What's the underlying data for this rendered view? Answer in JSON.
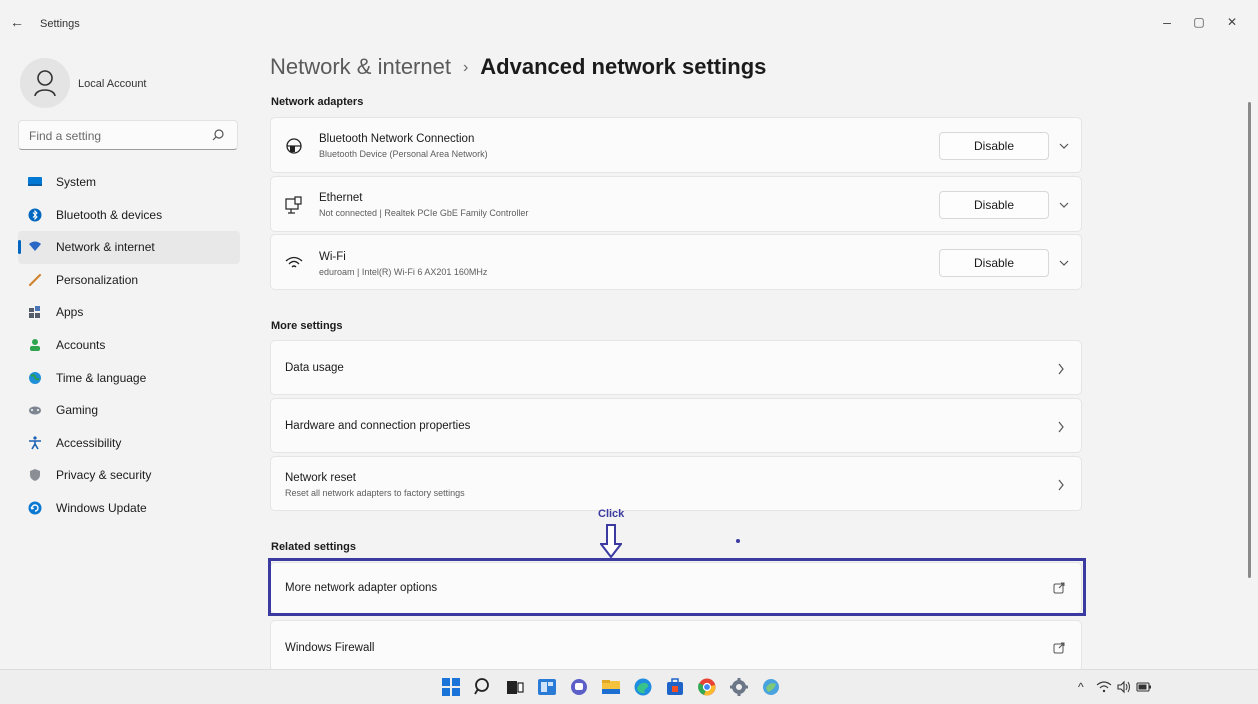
{
  "window": {
    "title": "Settings",
    "back_label": "←",
    "minimize_label": "–",
    "restore_label": "▢",
    "close_label": "✕"
  },
  "account": {
    "name": "Local Account"
  },
  "search": {
    "placeholder": "Find a setting"
  },
  "sidebar": {
    "items": [
      {
        "label": "System",
        "icon": "system-icon",
        "color": "#0078d4"
      },
      {
        "label": "Bluetooth & devices",
        "icon": "bluetooth-icon",
        "color": "#0067c0"
      },
      {
        "label": "Network & internet",
        "icon": "wifi-icon",
        "color": "#2b67c4",
        "active": true
      },
      {
        "label": "Personalization",
        "icon": "brush-icon",
        "color": "#d08431"
      },
      {
        "label": "Apps",
        "icon": "apps-icon",
        "color": "#555d6b"
      },
      {
        "label": "Accounts",
        "icon": "person-icon",
        "color": "#2fa44f"
      },
      {
        "label": "Time & language",
        "icon": "globe-clock-icon",
        "color": "#1f8fd6"
      },
      {
        "label": "Gaming",
        "icon": "gamepad-icon",
        "color": "#7e8791"
      },
      {
        "label": "Accessibility",
        "icon": "accessibility-icon",
        "color": "#1a5fb4"
      },
      {
        "label": "Privacy & security",
        "icon": "shield-icon",
        "color": "#8a8f96"
      },
      {
        "label": "Windows Update",
        "icon": "update-icon",
        "color": "#0b78d1"
      }
    ]
  },
  "page": {
    "breadcrumb_parent": "Network & internet",
    "breadcrumb_sep": "›",
    "title": "Advanced network settings"
  },
  "sections": {
    "adapters_title": "Network adapters",
    "more_title": "More settings",
    "related_title": "Related settings"
  },
  "adapters": [
    {
      "name": "Bluetooth Network Connection",
      "desc": "Bluetooth Device (Personal Area Network)",
      "button": "Disable",
      "icon": "bluetooth-network-icon"
    },
    {
      "name": "Ethernet",
      "desc": "Not connected | Realtek PCIe GbE Family Controller",
      "button": "Disable",
      "icon": "ethernet-icon"
    },
    {
      "name": "Wi-Fi",
      "desc": "eduroam | Intel(R) Wi-Fi 6 AX201 160MHz",
      "button": "Disable",
      "icon": "wifi-icon"
    }
  ],
  "more_settings": [
    {
      "label": "Data usage",
      "desc": ""
    },
    {
      "label": "Hardware and connection properties",
      "desc": ""
    },
    {
      "label": "Network reset",
      "desc": "Reset all network adapters to factory settings"
    }
  ],
  "related_settings": [
    {
      "label": "More network adapter options"
    },
    {
      "label": "Windows Firewall"
    }
  ],
  "annotation": {
    "text": "Click",
    "color": "#3a3aa0"
  },
  "taskbar": {
    "apps": [
      "start-icon",
      "search-icon",
      "task-view-icon",
      "widgets-icon",
      "chat-icon",
      "file-explorer-icon",
      "edge-icon",
      "store-icon",
      "chrome-icon",
      "settings-icon",
      "app-icon"
    ]
  },
  "colors": {
    "accent": "#0067c0",
    "annotation": "#3a3aa0",
    "background": "#f3f3f3",
    "card": "#fbfbfb"
  }
}
